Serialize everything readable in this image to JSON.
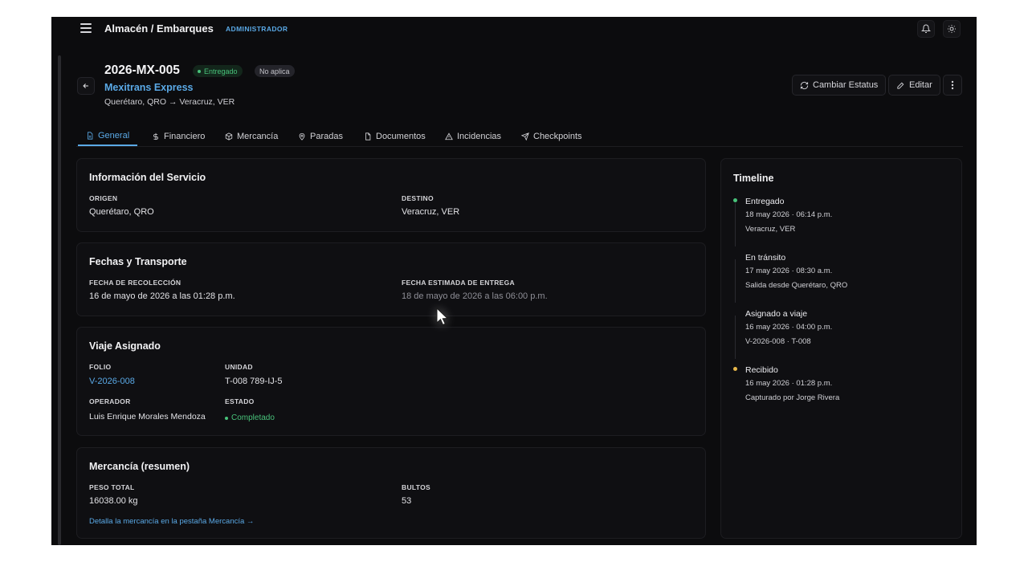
{
  "topbar": {
    "title": "Almacén / Embarques",
    "role": "ADMINISTRADOR"
  },
  "header": {
    "shipment_id": "2026-MX-005",
    "status": "Entregado",
    "secondary_badge": "No aplica",
    "carrier": "Mexitrans Express",
    "route": "Querétaro, QRO → Veracruz, VER",
    "change_status_label": "Cambiar Estatus",
    "edit_label": "Editar"
  },
  "tabs": [
    {
      "label": "General",
      "icon": "document-icon"
    },
    {
      "label": "Financiero",
      "icon": "dollar-icon"
    },
    {
      "label": "Mercancía",
      "icon": "box-icon"
    },
    {
      "label": "Paradas",
      "icon": "map-pin-icon"
    },
    {
      "label": "Documentos",
      "icon": "file-icon"
    },
    {
      "label": "Incidencias",
      "icon": "warning-icon"
    },
    {
      "label": "Checkpoints",
      "icon": "send-icon"
    }
  ],
  "service_info": {
    "title": "Información del Servicio",
    "origin_label": "ORIGEN",
    "origin": "Querétaro, QRO",
    "destination_label": "DESTINO",
    "destination": "Veracruz, VER"
  },
  "dates": {
    "title": "Fechas y Transporte",
    "pickup_label": "FECHA DE RECOLECCIÓN",
    "pickup": "16 de mayo de 2026 a las 01:28 p.m.",
    "eta_label": "FECHA ESTIMADA DE ENTREGA",
    "eta": "18 de mayo de 2026 a las 06:00 p.m."
  },
  "trip": {
    "title": "Viaje Asignado",
    "folio_label": "FOLIO",
    "folio": "V-2026-008",
    "unit_label": "UNIDAD",
    "unit": "T-008 789-IJ-5",
    "operator_label": "OPERADOR",
    "operator": "Luis Enrique Morales Mendoza",
    "state_label": "ESTADO",
    "state": "Completado"
  },
  "goods": {
    "title": "Mercancía (resumen)",
    "weight_label": "PESO TOTAL",
    "weight": "16038.00 kg",
    "packages_label": "BULTOS",
    "packages": "53",
    "detail_link": "Detalla la mercancía en la pestaña Mercancía →"
  },
  "timeline": {
    "title": "Timeline",
    "events": [
      {
        "name": "Entregado",
        "time": "18 may 2026 · 06:14 p.m.",
        "note": "Veracruz, VER",
        "color": "#48c27a"
      },
      {
        "name": "En tránsito",
        "time": "17 may 2026 · 08:30 a.m.",
        "note": "Salida desde Querétaro, QRO",
        "color": ""
      },
      {
        "name": "Asignado a viaje",
        "time": "16 may 2026 · 04:00 p.m.",
        "note": "V-2026-008 · T-008",
        "color": ""
      },
      {
        "name": "Recibido",
        "time": "16 may 2026 · 01:28 p.m.",
        "note": "Capturado por Jorge Rivera",
        "color": "#e8b84a"
      }
    ]
  },
  "colors": {
    "accent": "#5aa9e6",
    "success": "#48c27a",
    "pending": "#e8b84a",
    "background": "#0c0c0e"
  }
}
